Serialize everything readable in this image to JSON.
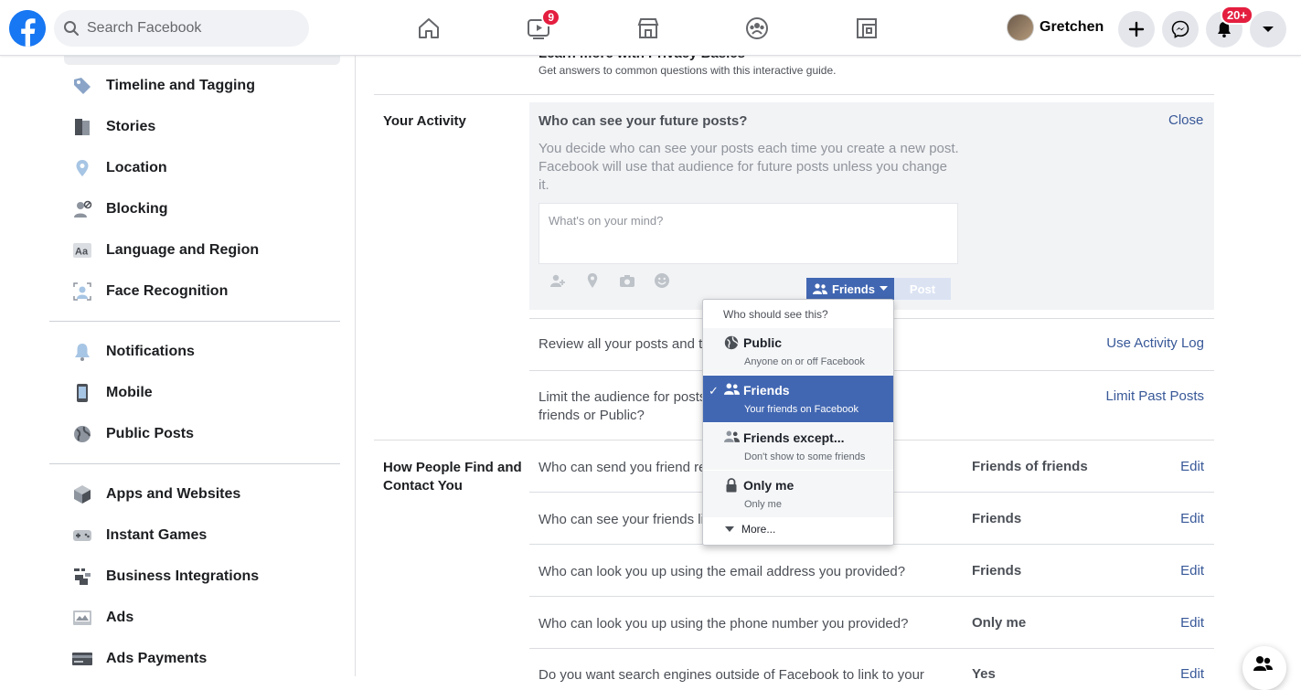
{
  "topbar": {
    "search_placeholder": "Search Facebook",
    "watch_badge": "9",
    "profile_name": "Gretchen",
    "notif_badge": "20+",
    "nav_icons": [
      "home-icon",
      "watch-icon",
      "marketplace-icon",
      "groups-icon",
      "gaming-icon"
    ],
    "accent": "#1877f2"
  },
  "sidebar": {
    "items": [
      {
        "label": "Timeline and Tagging",
        "icon": "tag-icon"
      },
      {
        "label": "Stories",
        "icon": "book-icon"
      },
      {
        "label": "Location",
        "icon": "location-pin-icon"
      },
      {
        "label": "Blocking",
        "icon": "blocked-user-icon"
      },
      {
        "label": "Language and Region",
        "icon": "language-icon"
      },
      {
        "label": "Face Recognition",
        "icon": "face-recognition-icon"
      },
      {
        "label": "Notifications",
        "icon": "bell-icon"
      },
      {
        "label": "Mobile",
        "icon": "phone-icon"
      },
      {
        "label": "Public Posts",
        "icon": "globe-icon"
      },
      {
        "label": "Apps and Websites",
        "icon": "cube-icon"
      },
      {
        "label": "Instant Games",
        "icon": "gamepad-icon"
      },
      {
        "label": "Business Integrations",
        "icon": "business-icon"
      },
      {
        "label": "Ads",
        "icon": "ads-icon"
      },
      {
        "label": "Ads Payments",
        "icon": "credit-card-icon"
      }
    ]
  },
  "main": {
    "privacy_basics": {
      "title": "Learn more with Privacy Basics",
      "desc": "Get answers to common questions with this interactive guide."
    },
    "your_activity": {
      "section_title": "Your Activity",
      "future_posts_title": "Who can see your future posts?",
      "close_label": "Close",
      "future_posts_desc": "You decide who can see your posts each time you create a new post. Facebook will use that audience for future posts unless you change it.",
      "composer_placeholder": "What's on your mind?",
      "audience_label": "Friends",
      "post_label": "Post",
      "review_text": "Review all your posts and th",
      "review_link": "Use Activity Log",
      "limit_text": "Limit the audience for posts",
      "limit_text2": "friends or Public?",
      "limit_link": "Limit Past Posts"
    },
    "find_contact": {
      "section_title": "How People Find and Contact You",
      "rows": [
        {
          "question": "Who can send you friend re",
          "value": "Friends of friends",
          "action": "Edit"
        },
        {
          "question": "Who can see your friends li",
          "value": "Friends",
          "action": "Edit"
        },
        {
          "question": "Who can look you up using the email address you provided?",
          "value": "Friends",
          "action": "Edit"
        },
        {
          "question": "Who can look you up using the phone number you provided?",
          "value": "Only me",
          "action": "Edit"
        },
        {
          "question": "Do you want search engines outside of Facebook to link to your",
          "value": "Yes",
          "action": "Edit"
        }
      ]
    }
  },
  "dropdown": {
    "header": "Who should see this?",
    "options": [
      {
        "title": "Public",
        "sub": "Anyone on or off Facebook",
        "icon": "globe-icon",
        "selected": false
      },
      {
        "title": "Friends",
        "sub": "Your friends on Facebook",
        "icon": "friends-icon",
        "selected": true
      },
      {
        "title": "Friends except...",
        "sub": "Don't show to some friends",
        "icon": "friends-except-icon",
        "selected": false
      },
      {
        "title": "Only me",
        "sub": "Only me",
        "icon": "lock-icon",
        "selected": false
      }
    ],
    "more_label": "More...",
    "selected_color": "#4267b2"
  },
  "contacts_badge": "0"
}
